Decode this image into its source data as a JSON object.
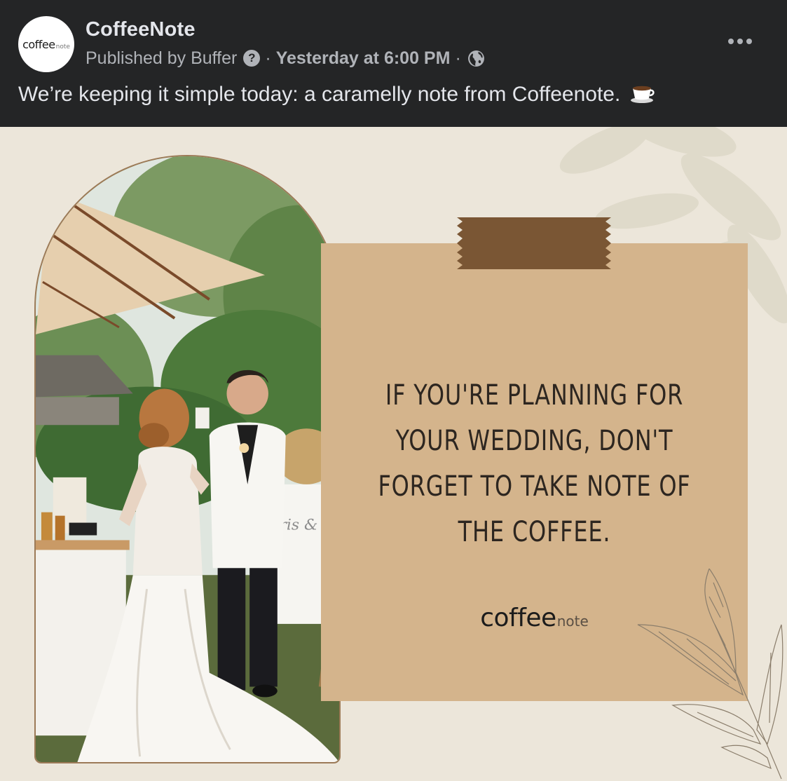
{
  "post": {
    "page_name": "CoffeeNote",
    "publisher": "Published by Buffer",
    "separator": "·",
    "timestamp": "Yesterday at 6:00 PM",
    "caption": "We’re keeping it simple today: a caramelly note from Coffeenote.",
    "caption_emoji": "coffee-cup-emoji",
    "avatar_logo": {
      "main": "coffee",
      "sub": "note"
    },
    "icons": {
      "help": "question-circle-icon",
      "audience": "globe-icon",
      "more": "more-options-icon"
    }
  },
  "image": {
    "photo_description_icon": "wedding-photo",
    "sign_text": "Iris & A",
    "quote": "IF YOU'RE PLANNING FOR\nYOUR WEDDING, DON'T\nFORGET TO TAKE NOTE OF\nTHE COFFEE.",
    "logo": {
      "main": "coffee",
      "sub": "note"
    }
  },
  "colors": {
    "surface": "#242526",
    "text_primary": "#e4e6eb",
    "text_secondary": "#b0b3b8",
    "image_background": "#ece6da",
    "note_card": "#d4b48c",
    "tape": "#7a5634",
    "quote_text": "#2d2620"
  }
}
